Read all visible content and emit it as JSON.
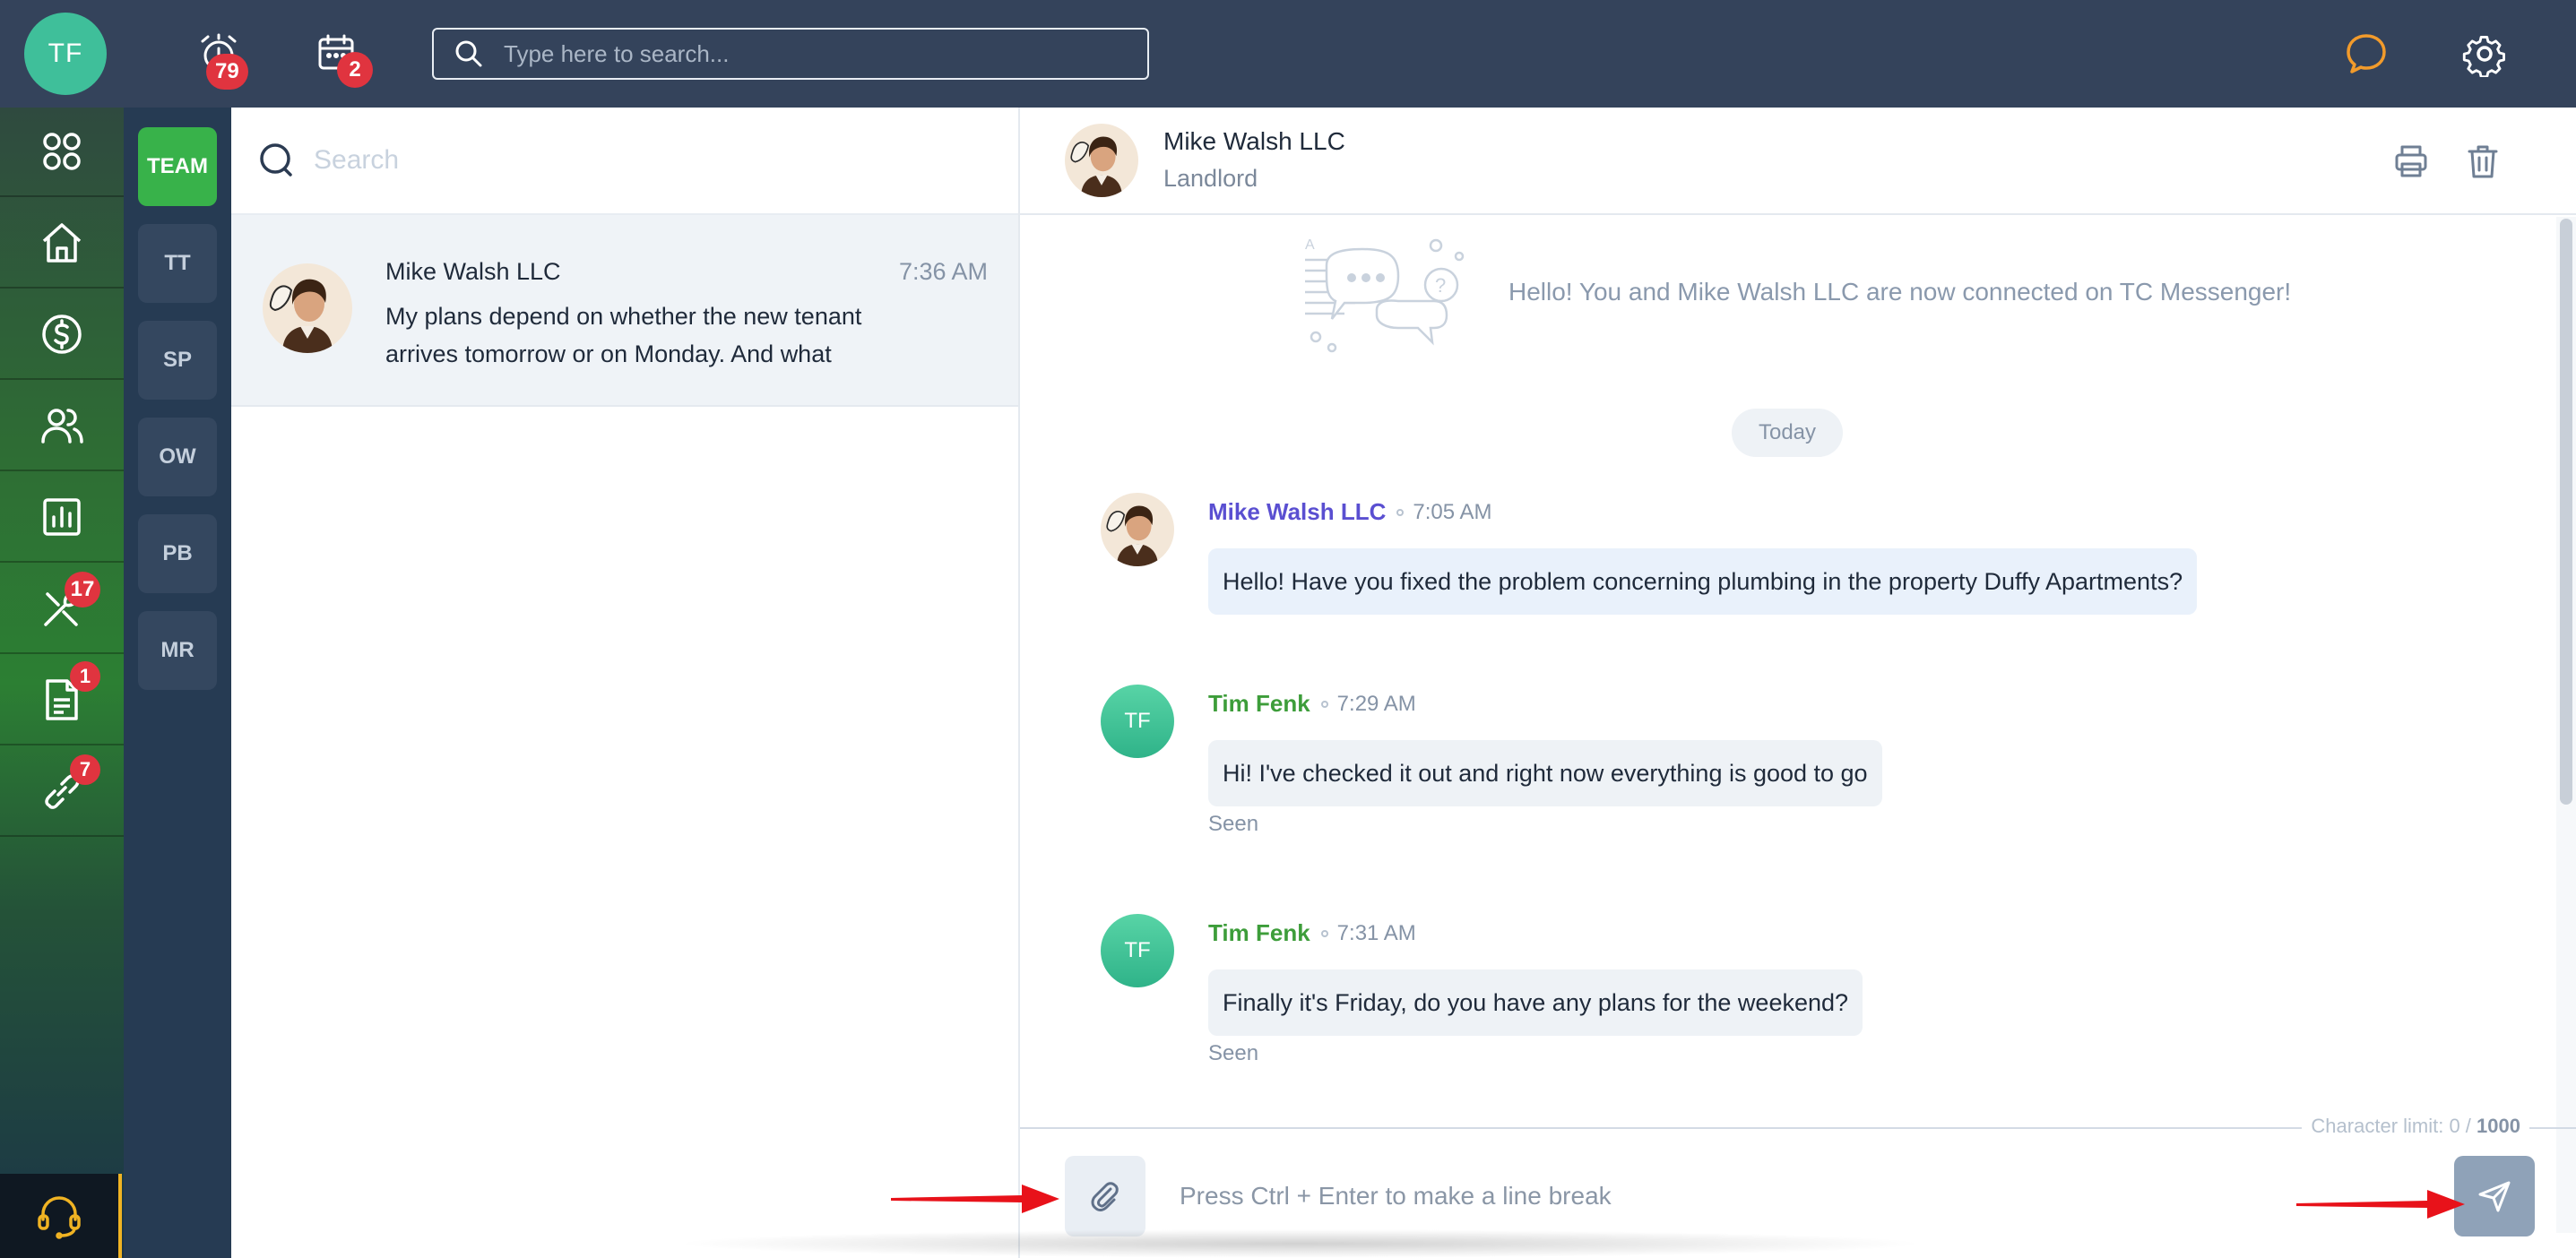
{
  "topbar": {
    "user_initials": "TF",
    "alarm_badge": "79",
    "calendar_badge": "2",
    "search_placeholder": "Type here to search..."
  },
  "leftnav": {
    "items": [
      {
        "icon": "apps-grid-icon",
        "badge": ""
      },
      {
        "icon": "home-icon",
        "badge": ""
      },
      {
        "icon": "dollar-circle-icon",
        "badge": ""
      },
      {
        "icon": "people-icon",
        "badge": ""
      },
      {
        "icon": "bar-chart-icon",
        "badge": ""
      },
      {
        "icon": "tools-icon",
        "badge": "17"
      },
      {
        "icon": "document-icon",
        "badge": "1"
      },
      {
        "icon": "link-icon",
        "badge": "7"
      }
    ],
    "support_icon": "headset-icon"
  },
  "teams": [
    "TEAM",
    "TT",
    "SP",
    "OW",
    "PB",
    "MR"
  ],
  "conversations": {
    "search_placeholder": "Search",
    "items": [
      {
        "name": "Mike Walsh LLC",
        "time": "7:36 AM",
        "snippet": "My plans depend on whether the new tenant arrives tomorrow or on Monday. And what"
      }
    ]
  },
  "chat": {
    "title": "Mike Walsh LLC",
    "subtitle": "Landlord",
    "intro": "Hello! You and Mike Walsh LLC are now connected on TC Messenger!",
    "date_separator": "Today",
    "messages": [
      {
        "sender": "Mike Walsh LLC",
        "time": "7:05 AM",
        "text": "Hello! Have you fixed the problem concerning plumbing in the property Duffy Apartments?",
        "status": ""
      },
      {
        "sender": "Tim Fenk",
        "initials": "TF",
        "time": "7:29 AM",
        "text": "Hi! I've checked it out and right now everything is good to go",
        "status": "Seen"
      },
      {
        "sender": "Tim Fenk",
        "initials": "TF",
        "time": "7:31 AM",
        "text": "Finally it's Friday, do you have any plans for the weekend?",
        "status": "Seen"
      }
    ],
    "composer": {
      "char_limit_label": "Character limit: 0 /",
      "char_limit_max": "1000",
      "placeholder": "Press Ctrl + Enter to make a line break"
    }
  },
  "colors": {
    "topbar": "#34435b",
    "accent_green": "#38b24a",
    "sender_mike": "#5a4fd1",
    "sender_tim": "#3d9d3a",
    "badge_red": "#e0343f",
    "chat_icon_orange": "#f29b2b",
    "annotation_arrow": "#e8121a"
  }
}
